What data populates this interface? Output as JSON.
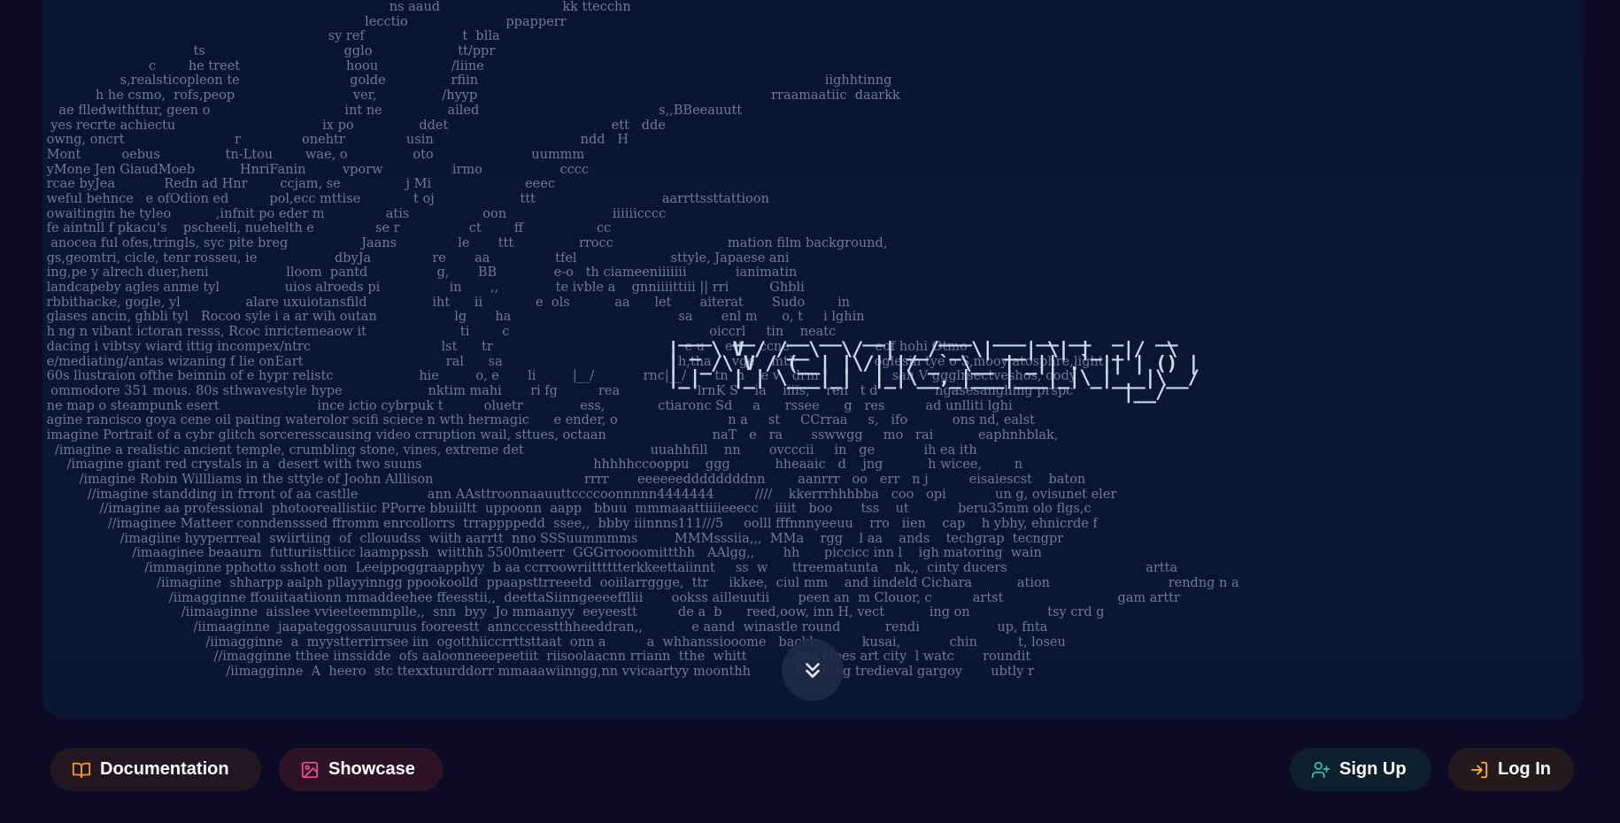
{
  "hero": {
    "ascii_lines": [
      "                                                                                     ns aaud                              kk ttecchn",
      "                                                                               lecctio                        ppapperr",
      "                                                                      sy ref                        t  blla",
      "                                     ts                                  gglo                     tt/ppr",
      "                          c        he treet                          hoou                  /liine",
      "                   s,realsticopleon te                           golde                rfiin                                                                                     iighhtinng",
      "             h he csmo,  rofs,peop                             ver,                /hyyp                                                                        rraamaatiic  daarkk",
      "    ae flledwithttur, geen o                                 int ne                ailed                                            s,,BBeeauutt",
      "  yes recrte achiectu                                    ix po                ddet                                        ett   dde",
      " owng, oncrt                           r               onehtr               usin                                    ndd   H",
      " Mont          oebus                tn-Ltou        wae, o                oto                        uummm",
      " yMone Jen GiaudMoeb           HnriFanin         vporw                 irmo                   cccc",
      " rcae byJea            Redn ad Hnr        ccjam, se                j Mi                       eeec",
      " weful behnce   e ofOdion ed          pol,ecc mttise             t oj                     ttt                               aarrttssttattioon",
      " owaitingin he tyleo           ,infnit po eder m               atis                  oon                          iiiiiicccc",
      " fe aintnll f pkacu's    pscheeli, nuehelth e               se r                 ct        ff                  cc",
      "  anocea ful ofes,tringls, syc pite breg                  Jaans               le       ttt                rrocc                            mation film background,",
      " gs,geomtri, cicle, tenr rosseu, ie                   dbyJa               re       aa                tfel                       sttyle, Japaese ani",
      " ing,pe y alrech duer,heni                   lloom  pantd                 g,       BB              e-o   th ciameeniiiiiii            ianimatin",
      " landcapeby agles anme tyl                uios alroeds pi                 in       ,,              te ivble a    gnniiiittiii || rri          Ghbli",
      " rbbithacke, gogle, yl                alare uxuiotansfild                iht      ii             e  ols           aa      let       aiterat       Sudo        in",
      " glases ancin, ghbli tyl   Rocoo syle i a ar wih outan                   lg       ha                                         sa       enl m      o, t     i lghin",
      " h ng n vibant ictoran resss, Rcoc inrictemeaow it                       ti        c                                                 oiccrl     tin    neatc",
      " dacing i vibtsy wiard ittig incompex/ntrc                                lst      tr                                               e u     ett    ccne                     eof hohi Otmo",
      " e/mediating/antas wizaning f lie onEart                                   ral      sa                                           h,tha     vge    mti                    oglesin tye o S,mooy atosphre,light",
      " 60s llustraion ofthe beinnin of e hypr relistc                     hie         o, e       li         |__/            rnc|__/       tn  n    e v   drm                  san V ggglrsectveshos, oody",
      "  ommodore 351 mous. 80s sthwavestyle hype                     nktim mahi       ri fg          rea                   lrnK S    ia    iiiis,    ren   t d              ngasesanghing prspc",
      " ne map o steampunk esert                        ince ictio cybrpuk t          oluetr              ess,             ctiaronc Sd     a      rssee      g   res          ad unlliti lghi",
      " agine rancisco goya cene oil paiting waterolor scifi sciece n wth hermagic      e ender, o                           n a     st     CCrraa     s,   ifo           ons nd, ealst",
      " imagine Portrait of a cybr glitch sorceresscausing video crruption wail, sttues, octaan                          naT   e   ra       sswwgg     mo   rai           eaphnhblak,",
      "   /imagine a realistic ancient temple, crumbling stone, vines, extreme det                               uuahhfill    nn       ovcccii     in   ge            ih ea ith",
      "      /imagine giant red crystals in a  desert with two suuns                                          hhhhhccooppu    ggg           hheaaic   d    jng           h wicee,        n",
      "         /imagine Robin Willliams in the sttyle of Joohn Alllison                                     rrrr       eeeeeeddddddddnn        aanrrr   oo   err   n j          eisaiescst    baton",
      "           //imagine standding in frront of aa castlle                 ann AAsttroonnaauuttccccoonnnnn4444444          ////    kkerrrhhhbba   coo   opi            un g, ovisunet eler",
      "              //imagine aa professional  photooreallistiic PPorre bbuiiltt  uppoonn  aapp   bbuu  mmmaaattiiiieeecc    iiiit   boo       tss    ut            beru35mm olo flgs,c",
      "                //imaginee Matteer conndensssed ffromm enrcollorrs  trrappppedd  ssee,,  bbby iiinnns111///5     oolll fffnnnyeeuu    rro   iien    cap    h ybhy, ehnicrde f",
      "                   /imagiine hyyperrreal  swiirtiing  of  cllouudss  wiith aarrtt  nno SSSuummmms         MMMsssiia,,,  MMa    rgg    l aa    ands    techgrap  tecngpr",
      "                      /imaaginee beaaurn  futturiisttiicc laamppssh  wiitthh 5500mteerr  GGGrroooomittthh   AAlgg,,       hh      piccicc inn l    igh matoring  wain",
      "                         /immaginne pphotto sshott oon  Leeippoggraapphyy  b aa ccrroowriitttttterkkeettaiinnt     ss  w      ttreematunta    nk,,  cinty ducers                                  artta",
      "                            /iimagiine  shharpp aalph pllayyinngg ppookoolld  ppaapsttrreeetd  ooiilarrggge,  ttr     ikkee,  ciul mm    and iindeld Cichara           ation                             rendng n a",
      "                               /iimagginne ffouiitaatiionn mmaddeehee ffeesstii,,  deettaSiinngeeeeffllii       ookss ailleuutii       peen an  m Clouor, c          artst                            gam arttr",
      "                                  /iimaaginne  aisslee vvieeteemmplle,,  snn  byy  Jo mmaanyy  eeyeestt          de a  b      reed,oow, inn H, vect           ing on                   tsy crd g",
      "                                     /iimaaginne  jaapateggossauuruus fooreestt  anncccesstthheeddran,,            e aand  winastle round           rendi                   up, fnta",
      "                                        /iimagginne  a  myystterrirrsee iin  ogotthiiccrrttsttaat  onn a          a  whhanssiooome   backk           kusai,            chin          t, loseu",
      "                                          //imagginne tthee iinssidde  ofs aaloonneeepeetiit  riisoolaacnn rriann  tthe  whitt            kaa Hoes art city  l watc       roundit",
      "                                             /iimagginne  A  heero  stc ttexxtuurddorr mmaaawiinngg,nn vvicaartyy moonthh           tsushing tredieval gargoy       ubtly r"
    ],
    "logo_art": " ___  __   __ __  __     ___  ___ __ __  _   __\n| _ \\ V / /__\\  \\/  | __/ _ \\| __| \\| |_ _|/  \\\n|  _/\\ V / (__| |\\/| |/ _` \\__ | _|| .` || | () |\n|_|   |_| \\___|_|  |_|\\__,_|___|___|_|\\_|___|\\__/\n                                          |__/"
  },
  "scroll_button": {
    "icon": "chevrons-down-icon"
  },
  "nav": {
    "documentation": {
      "label": "Documentation",
      "icon": "book-icon",
      "icon_color": "#f7931e"
    },
    "showcase": {
      "label": "Showcase",
      "icon": "image-icon",
      "icon_color": "#e84d8a"
    },
    "signup": {
      "label": "Sign Up",
      "icon": "user-plus-icon",
      "icon_color": "#2ec4a8"
    },
    "login": {
      "label": "Log In",
      "icon": "log-in-icon",
      "icon_color": "#f5b921"
    }
  },
  "colors": {
    "page_background": "#0d0a26",
    "panel_background": "#0a1734",
    "ascii_text": "#6e7b96",
    "logo_text": "#d2d8e6"
  }
}
